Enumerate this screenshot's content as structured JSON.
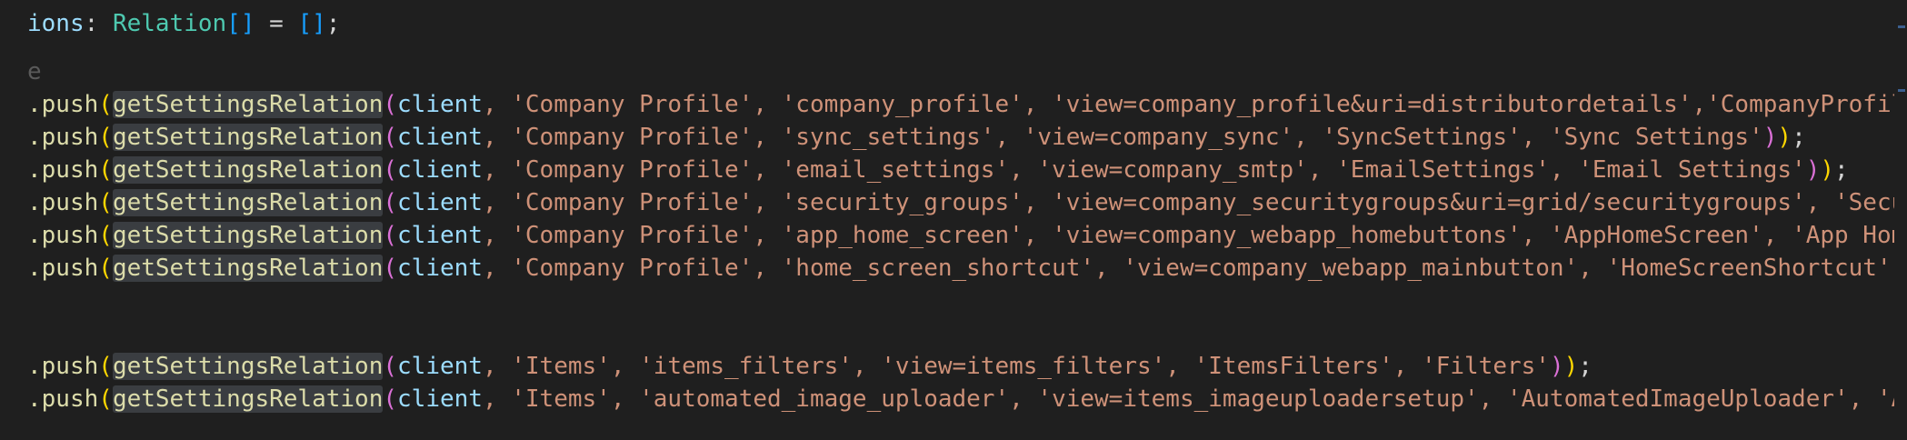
{
  "editor": {
    "lines": [
      {
        "id": "decl",
        "prefix": "ions",
        "colon": ": ",
        "type": "Relation",
        "brackets": "[]",
        "eq": " = ",
        "init": "[]",
        "end": ";"
      },
      {
        "id": "comment",
        "text": "e"
      },
      {
        "id": "r1",
        "obj": ".push",
        "fn": "getSettingsRelation",
        "arg": "client",
        "rest": ", 'Company Profile', 'company_profile', 'view=company_profile&uri=distributordetails','CompanyProfile','Compan",
        "tail": ""
      },
      {
        "id": "r2",
        "obj": ".push",
        "fn": "getSettingsRelation",
        "arg": "client",
        "rest": ", 'Company Profile', 'sync_settings', 'view=company_sync', 'SyncSettings', 'Sync Settings'",
        "tail": "));"
      },
      {
        "id": "r3",
        "obj": ".push",
        "fn": "getSettingsRelation",
        "arg": "client",
        "rest": ", 'Company Profile', 'email_settings', 'view=company_smtp', 'EmailSettings', 'Email Settings'",
        "tail": "));"
      },
      {
        "id": "r4",
        "obj": ".push",
        "fn": "getSettingsRelation",
        "arg": "client",
        "rest": ", 'Company Profile', 'security_groups', 'view=company_securitygroups&uri=grid/securitygroups', 'SecurityGroups",
        "tail": ""
      },
      {
        "id": "r5",
        "obj": ".push",
        "fn": "getSettingsRelation",
        "arg": "client",
        "rest": ", 'Company Profile', 'app_home_screen', 'view=company_webapp_homebuttons', 'AppHomeScreen', 'App Home Screen'",
        "tail": ")"
      },
      {
        "id": "r6",
        "obj": ".push",
        "fn": "getSettingsRelation",
        "arg": "client",
        "rest": ", 'Company Profile', 'home_screen_shortcut', 'view=company_webapp_mainbutton', 'HomeScreenShortcut', 'Home Scr",
        "tail": ""
      },
      {
        "id": "r7",
        "obj": ".push",
        "fn": "getSettingsRelation",
        "arg": "client",
        "rest": ", 'Items', 'items_filters', 'view=items_filters', 'ItemsFilters', 'Filters'",
        "tail": "));"
      },
      {
        "id": "r8",
        "obj": ".push",
        "fn": "getSettingsRelation",
        "arg": "client",
        "rest": ", 'Items', 'automated_image_uploader', 'view=items_imageuploadersetup', 'AutomatedImageUploader', 'Automated I",
        "tail": ""
      }
    ]
  }
}
